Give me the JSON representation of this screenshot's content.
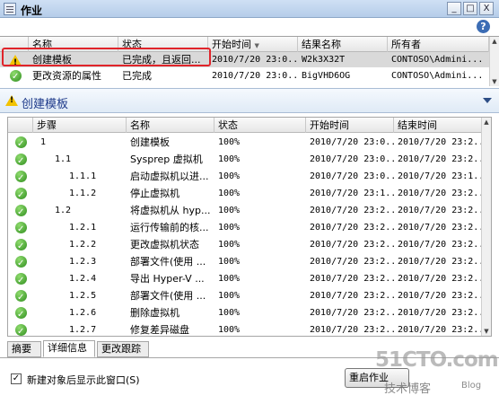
{
  "window": {
    "title": "作业",
    "minimize": "_",
    "maximize": "□",
    "close": "X",
    "help": "?"
  },
  "jobs": {
    "columns": [
      "",
      "名称",
      "状态",
      "开始时间",
      "结果名称",
      "所有者"
    ],
    "rows": [
      {
        "name": "创建模板",
        "status": "已完成，且返回...",
        "start": "2010/7/20 23:0...",
        "result": "W2k3X32T",
        "owner": "CONTOSO\\Admini...",
        "icon": "warning-icon"
      },
      {
        "name": "更改资源的属性",
        "status": "已完成",
        "start": "2010/7/20 23:0...",
        "result": "BigVHD6OG",
        "owner": "CONTOSO\\Admini...",
        "icon": "success-icon"
      }
    ]
  },
  "detail": {
    "title": "创建模板"
  },
  "steps": {
    "columns": [
      "",
      "步骤",
      "名称",
      "状态",
      "开始时间",
      "结束时间"
    ],
    "rows": [
      {
        "step": "1",
        "level": 0,
        "name": "创建模板",
        "status": "100%",
        "start": "2010/7/20 23:0...",
        "end": "2010/7/20 23:2..."
      },
      {
        "step": "1.1",
        "level": 1,
        "name": "Sysprep 虚拟机",
        "status": "100%",
        "start": "2010/7/20 23:0...",
        "end": "2010/7/20 23:2..."
      },
      {
        "step": "1.1.1",
        "level": 2,
        "name": "启动虚拟机以进...",
        "status": "100%",
        "start": "2010/7/20 23:0...",
        "end": "2010/7/20 23:1..."
      },
      {
        "step": "1.1.2",
        "level": 2,
        "name": "停止虚拟机",
        "status": "100%",
        "start": "2010/7/20 23:1...",
        "end": "2010/7/20 23:2..."
      },
      {
        "step": "1.2",
        "level": 1,
        "name": "将虚拟机从 hyp...",
        "status": "100%",
        "start": "2010/7/20 23:2...",
        "end": "2010/7/20 23:2..."
      },
      {
        "step": "1.2.1",
        "level": 2,
        "name": "运行传输前的核...",
        "status": "100%",
        "start": "2010/7/20 23:2...",
        "end": "2010/7/20 23:2..."
      },
      {
        "step": "1.2.2",
        "level": 2,
        "name": "更改虚拟机状态",
        "status": "100%",
        "start": "2010/7/20 23:2...",
        "end": "2010/7/20 23:2..."
      },
      {
        "step": "1.2.3",
        "level": 2,
        "name": "部署文件(使用 ...",
        "status": "100%",
        "start": "2010/7/20 23:2...",
        "end": "2010/7/20 23:2..."
      },
      {
        "step": "1.2.4",
        "level": 2,
        "name": "导出 Hyper-V ...",
        "status": "100%",
        "start": "2010/7/20 23:2...",
        "end": "2010/7/20 23:2..."
      },
      {
        "step": "1.2.5",
        "level": 2,
        "name": "部署文件(使用 ...",
        "status": "100%",
        "start": "2010/7/20 23:2...",
        "end": "2010/7/20 23:2..."
      },
      {
        "step": "1.2.6",
        "level": 2,
        "name": "删除虚拟机",
        "status": "100%",
        "start": "2010/7/20 23:2...",
        "end": "2010/7/20 23:2..."
      },
      {
        "step": "1.2.7",
        "level": 2,
        "name": "修复差异磁盘",
        "status": "100%",
        "start": "2010/7/20 23:2...",
        "end": "2010/7/20 23:2..."
      }
    ]
  },
  "tabs": [
    "摘要",
    "详细信息",
    "更改跟踪"
  ],
  "footer": {
    "checkbox_label": "新建对象后显示此窗口(S)",
    "checkbox_mark": "✓",
    "restart_button": "重启作业"
  },
  "watermark": {
    "main": "51CTO.com",
    "sub": "技术博客",
    "blog": "Blog"
  }
}
